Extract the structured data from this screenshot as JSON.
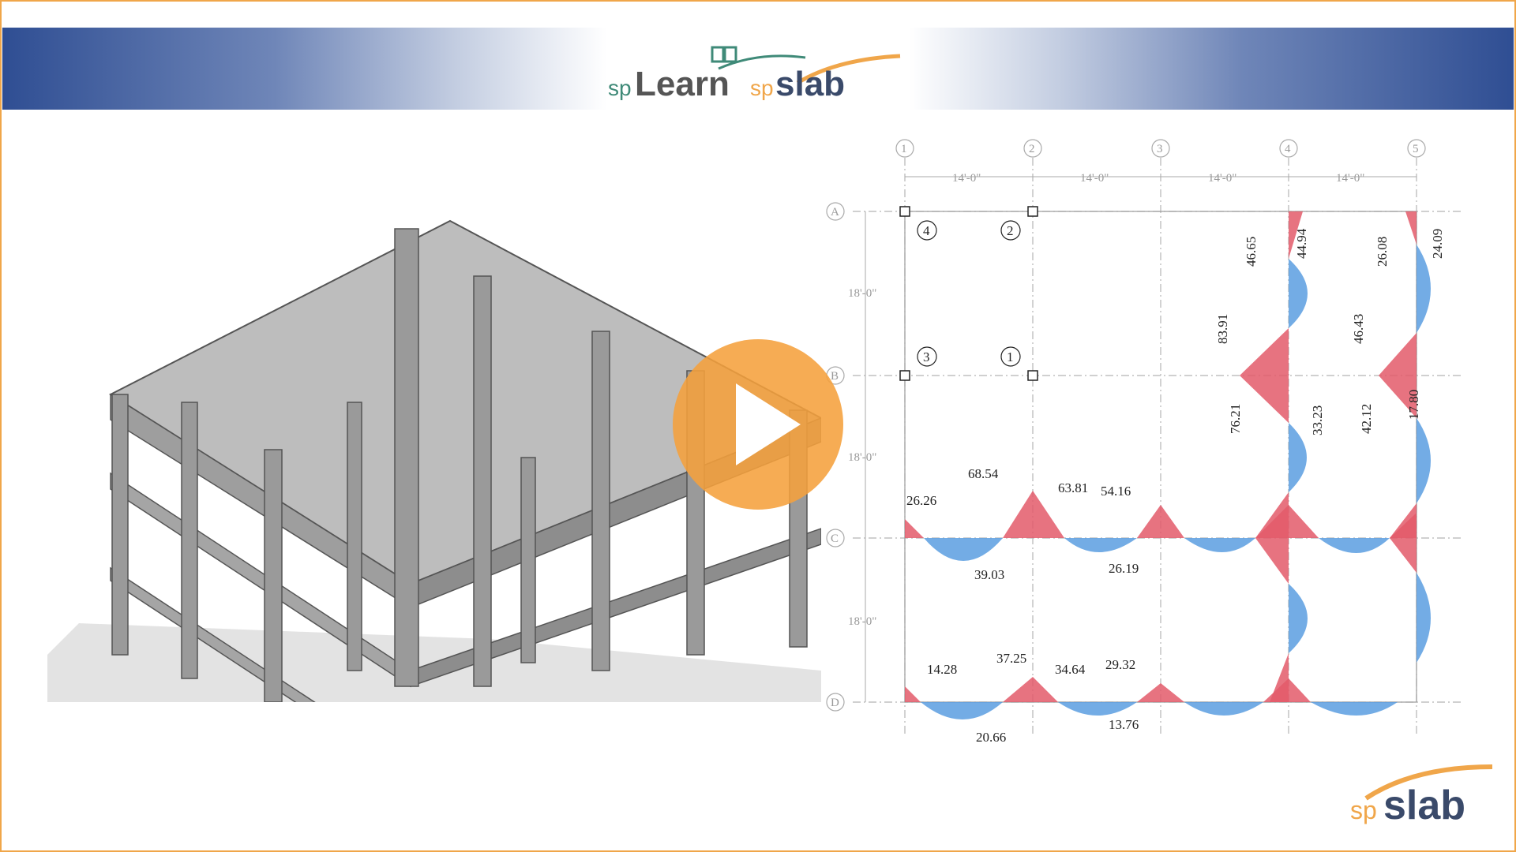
{
  "header": {
    "logo_sp1": "sp",
    "logo_learn": "Learn",
    "logo_sp2": "sp",
    "logo_slab": "slab"
  },
  "footer_logo": {
    "sp": "sp",
    "slab": "slab"
  },
  "play_button": {
    "icon": "play-icon"
  },
  "plan": {
    "grid_columns": [
      "1",
      "2",
      "3",
      "4",
      "5"
    ],
    "grid_rows": [
      "A",
      "B",
      "C",
      "D"
    ],
    "span_x_dims": [
      "14'-0\"",
      "14'-0\"",
      "14'-0\"",
      "14'-0\""
    ],
    "span_y_dims": [
      "18'-0\"",
      "18'-0\"",
      "18'-0\""
    ],
    "strip_tags": [
      "4",
      "2",
      "3",
      "1"
    ],
    "moments_vertical": [
      "46.65",
      "44.94",
      "26.08",
      "24.09",
      "83.91",
      "46.43",
      "76.21",
      "33.23",
      "42.12",
      "17.80"
    ],
    "moments_row_c": [
      "68.54",
      "26.26",
      "63.81",
      "54.16",
      "39.03",
      "26.19"
    ],
    "moments_row_d": [
      "14.28",
      "37.25",
      "34.64",
      "29.32",
      "20.66",
      "13.76"
    ]
  },
  "colors": {
    "negative": "#e35a6a",
    "positive": "#5b9ee0",
    "accent": "#f0a64a",
    "brand_blue": "#2f4e93",
    "brand_green": "#3f8a78"
  }
}
